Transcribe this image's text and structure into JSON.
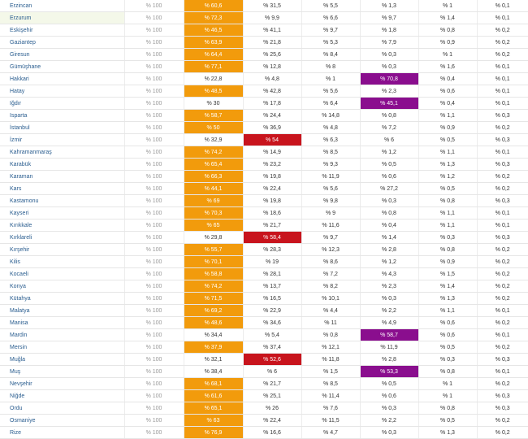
{
  "colors": {
    "orange": "#f29b0c",
    "red": "#c8141d",
    "purple": "#8a0e8e",
    "province_link": "#2a5d8f"
  },
  "rows": [
    {
      "province": "Erzincan",
      "total": "% 100",
      "c2": "% 60,6",
      "c3": "% 31,5",
      "c4": "% 5,5",
      "c5": "% 1,3",
      "c6": "% 1",
      "c7": "% 0,1",
      "hl2": "orange",
      "hl3": "",
      "hl5": ""
    },
    {
      "province": "Erzurum",
      "total": "% 100",
      "c2": "% 72,3",
      "c3": "% 9,9",
      "c4": "% 6,6",
      "c5": "% 9,7",
      "c6": "% 1,4",
      "c7": "% 0,1",
      "hl2": "orange",
      "hl3": "",
      "hl5": "",
      "selected": true
    },
    {
      "province": "Eskişehir",
      "total": "% 100",
      "c2": "% 46,5",
      "c3": "% 41,1",
      "c4": "% 9,7",
      "c5": "% 1,8",
      "c6": "% 0,8",
      "c7": "% 0,2",
      "hl2": "orange",
      "hl3": "",
      "hl5": ""
    },
    {
      "province": "Gaziantep",
      "total": "% 100",
      "c2": "% 63,9",
      "c3": "% 21,8",
      "c4": "% 5,3",
      "c5": "% 7,9",
      "c6": "% 0,9",
      "c7": "% 0,2",
      "hl2": "orange",
      "hl3": "",
      "hl5": ""
    },
    {
      "province": "Giresun",
      "total": "% 100",
      "c2": "% 64,4",
      "c3": "% 25,6",
      "c4": "% 8,4",
      "c5": "% 0,3",
      "c6": "% 1",
      "c7": "% 0,2",
      "hl2": "orange",
      "hl3": "",
      "hl5": ""
    },
    {
      "province": "Gümüşhane",
      "total": "% 100",
      "c2": "% 77,1",
      "c3": "% 12,8",
      "c4": "% 8",
      "c5": "% 0,3",
      "c6": "% 1,6",
      "c7": "% 0,1",
      "hl2": "orange",
      "hl3": "",
      "hl5": ""
    },
    {
      "province": "Hakkari",
      "total": "% 100",
      "c2": "% 22,8",
      "c3": "% 4,8",
      "c4": "% 1",
      "c5": "% 70,8",
      "c6": "% 0,4",
      "c7": "% 0,1",
      "hl2": "",
      "hl3": "",
      "hl5": "purple"
    },
    {
      "province": "Hatay",
      "total": "% 100",
      "c2": "% 48,5",
      "c3": "% 42,8",
      "c4": "% 5,6",
      "c5": "% 2,3",
      "c6": "% 0,6",
      "c7": "% 0,1",
      "hl2": "orange",
      "hl3": "",
      "hl5": ""
    },
    {
      "province": "Iğdır",
      "total": "% 100",
      "c2": "% 30",
      "c3": "% 17,8",
      "c4": "% 6,4",
      "c5": "% 45,1",
      "c6": "% 0,4",
      "c7": "% 0,1",
      "hl2": "",
      "hl3": "",
      "hl5": "purple"
    },
    {
      "province": "Isparta",
      "total": "% 100",
      "c2": "% 58,7",
      "c3": "% 24,4",
      "c4": "% 14,8",
      "c5": "% 0,8",
      "c6": "% 1,1",
      "c7": "% 0,3",
      "hl2": "orange",
      "hl3": "",
      "hl5": ""
    },
    {
      "province": "İstanbul",
      "total": "% 100",
      "c2": "% 50",
      "c3": "% 36,9",
      "c4": "% 4,8",
      "c5": "% 7,2",
      "c6": "% 0,9",
      "c7": "% 0,2",
      "hl2": "orange",
      "hl3": "",
      "hl5": ""
    },
    {
      "province": "İzmir",
      "total": "% 100",
      "c2": "% 32,9",
      "c3": "% 54",
      "c4": "% 6,3",
      "c5": "% 6",
      "c6": "% 0,5",
      "c7": "% 0,3",
      "hl2": "",
      "hl3": "red",
      "hl5": ""
    },
    {
      "province": "Kahramanmaraş",
      "total": "% 100",
      "c2": "% 74,2",
      "c3": "% 14,9",
      "c4": "% 8,5",
      "c5": "% 1,2",
      "c6": "% 1,1",
      "c7": "% 0,1",
      "hl2": "orange",
      "hl3": "",
      "hl5": ""
    },
    {
      "province": "Karabük",
      "total": "% 100",
      "c2": "% 65,4",
      "c3": "% 23,2",
      "c4": "% 9,3",
      "c5": "% 0,5",
      "c6": "% 1,3",
      "c7": "% 0,3",
      "hl2": "orange",
      "hl3": "",
      "hl5": ""
    },
    {
      "province": "Karaman",
      "total": "% 100",
      "c2": "% 66,3",
      "c3": "% 19,8",
      "c4": "% 11,9",
      "c5": "% 0,6",
      "c6": "% 1,2",
      "c7": "% 0,2",
      "hl2": "orange",
      "hl3": "",
      "hl5": ""
    },
    {
      "province": "Kars",
      "total": "% 100",
      "c2": "% 44,1",
      "c3": "% 22,4",
      "c4": "% 5,6",
      "c5": "% 27,2",
      "c6": "% 0,5",
      "c7": "% 0,2",
      "hl2": "orange",
      "hl3": "",
      "hl5": ""
    },
    {
      "province": "Kastamonu",
      "total": "% 100",
      "c2": "% 69",
      "c3": "% 19,8",
      "c4": "% 9,8",
      "c5": "% 0,3",
      "c6": "% 0,8",
      "c7": "% 0,3",
      "hl2": "orange",
      "hl3": "",
      "hl5": ""
    },
    {
      "province": "Kayseri",
      "total": "% 100",
      "c2": "% 70,3",
      "c3": "% 18,6",
      "c4": "% 9",
      "c5": "% 0,8",
      "c6": "% 1,1",
      "c7": "% 0,1",
      "hl2": "orange",
      "hl3": "",
      "hl5": ""
    },
    {
      "province": "Kırıkkale",
      "total": "% 100",
      "c2": "% 65",
      "c3": "% 21,7",
      "c4": "% 11,6",
      "c5": "% 0,4",
      "c6": "% 1,1",
      "c7": "% 0,1",
      "hl2": "orange",
      "hl3": "",
      "hl5": ""
    },
    {
      "province": "Kırklareli",
      "total": "% 100",
      "c2": "% 29,8",
      "c3": "% 58,4",
      "c4": "% 9,7",
      "c5": "% 1,4",
      "c6": "% 0,3",
      "c7": "% 0,3",
      "hl2": "",
      "hl3": "red",
      "hl5": ""
    },
    {
      "province": "Kırşehir",
      "total": "% 100",
      "c2": "% 55,7",
      "c3": "% 28,3",
      "c4": "% 12,3",
      "c5": "% 2,8",
      "c6": "% 0,8",
      "c7": "% 0,2",
      "hl2": "orange",
      "hl3": "",
      "hl5": ""
    },
    {
      "province": "Kilis",
      "total": "% 100",
      "c2": "% 70,1",
      "c3": "% 19",
      "c4": "% 8,6",
      "c5": "% 1,2",
      "c6": "% 0,9",
      "c7": "% 0,2",
      "hl2": "orange",
      "hl3": "",
      "hl5": ""
    },
    {
      "province": "Kocaeli",
      "total": "% 100",
      "c2": "% 58,8",
      "c3": "% 28,1",
      "c4": "% 7,2",
      "c5": "% 4,3",
      "c6": "% 1,5",
      "c7": "% 0,2",
      "hl2": "orange",
      "hl3": "",
      "hl5": ""
    },
    {
      "province": "Konya",
      "total": "% 100",
      "c2": "% 74,2",
      "c3": "% 13,7",
      "c4": "% 8,2",
      "c5": "% 2,3",
      "c6": "% 1,4",
      "c7": "% 0,2",
      "hl2": "orange",
      "hl3": "",
      "hl5": ""
    },
    {
      "province": "Kütahya",
      "total": "% 100",
      "c2": "% 71,5",
      "c3": "% 16,5",
      "c4": "% 10,1",
      "c5": "% 0,3",
      "c6": "% 1,3",
      "c7": "% 0,2",
      "hl2": "orange",
      "hl3": "",
      "hl5": ""
    },
    {
      "province": "Malatya",
      "total": "% 100",
      "c2": "% 69,2",
      "c3": "% 22,9",
      "c4": "% 4,4",
      "c5": "% 2,2",
      "c6": "% 1,1",
      "c7": "% 0,1",
      "hl2": "orange",
      "hl3": "",
      "hl5": ""
    },
    {
      "province": "Manisa",
      "total": "% 100",
      "c2": "% 48,6",
      "c3": "% 34,6",
      "c4": "% 11",
      "c5": "% 4,9",
      "c6": "% 0,6",
      "c7": "% 0,2",
      "hl2": "orange",
      "hl3": "",
      "hl5": ""
    },
    {
      "province": "Mardin",
      "total": "% 100",
      "c2": "% 34,4",
      "c3": "% 5,4",
      "c4": "% 0,8",
      "c5": "% 58,7",
      "c6": "% 0,6",
      "c7": "% 0,1",
      "hl2": "",
      "hl3": "",
      "hl5": "purple"
    },
    {
      "province": "Mersin",
      "total": "% 100",
      "c2": "% 37,9",
      "c3": "% 37,4",
      "c4": "% 12,1",
      "c5": "% 11,9",
      "c6": "% 0,5",
      "c7": "% 0,2",
      "hl2": "orange",
      "hl3": "",
      "hl5": ""
    },
    {
      "province": "Muğla",
      "total": "% 100",
      "c2": "% 32,1",
      "c3": "% 52,6",
      "c4": "% 11,8",
      "c5": "% 2,8",
      "c6": "% 0,3",
      "c7": "% 0,3",
      "hl2": "",
      "hl3": "red",
      "hl5": ""
    },
    {
      "province": "Muş",
      "total": "% 100",
      "c2": "% 38,4",
      "c3": "% 6",
      "c4": "% 1,5",
      "c5": "% 53,3",
      "c6": "% 0,8",
      "c7": "% 0,1",
      "hl2": "",
      "hl3": "",
      "hl5": "purple"
    },
    {
      "province": "Nevşehir",
      "total": "% 100",
      "c2": "% 68,1",
      "c3": "% 21,7",
      "c4": "% 8,5",
      "c5": "% 0,5",
      "c6": "% 1",
      "c7": "% 0,2",
      "hl2": "orange",
      "hl3": "",
      "hl5": ""
    },
    {
      "province": "Niğde",
      "total": "% 100",
      "c2": "% 61,6",
      "c3": "% 25,1",
      "c4": "% 11,4",
      "c5": "% 0,6",
      "c6": "% 1",
      "c7": "% 0,3",
      "hl2": "orange",
      "hl3": "",
      "hl5": ""
    },
    {
      "province": "Ordu",
      "total": "% 100",
      "c2": "% 65,1",
      "c3": "% 26",
      "c4": "% 7,6",
      "c5": "% 0,3",
      "c6": "% 0,8",
      "c7": "% 0,3",
      "hl2": "orange",
      "hl3": "",
      "hl5": ""
    },
    {
      "province": "Osmaniye",
      "total": "% 100",
      "c2": "% 63",
      "c3": "% 22,4",
      "c4": "% 11,5",
      "c5": "% 2,2",
      "c6": "% 0,5",
      "c7": "% 0,2",
      "hl2": "orange",
      "hl3": "",
      "hl5": ""
    },
    {
      "province": "Rize",
      "total": "% 100",
      "c2": "% 76,9",
      "c3": "% 16,6",
      "c4": "% 4,7",
      "c5": "% 0,3",
      "c6": "% 1,3",
      "c7": "% 0,2",
      "hl2": "orange",
      "hl3": "",
      "hl5": ""
    }
  ]
}
